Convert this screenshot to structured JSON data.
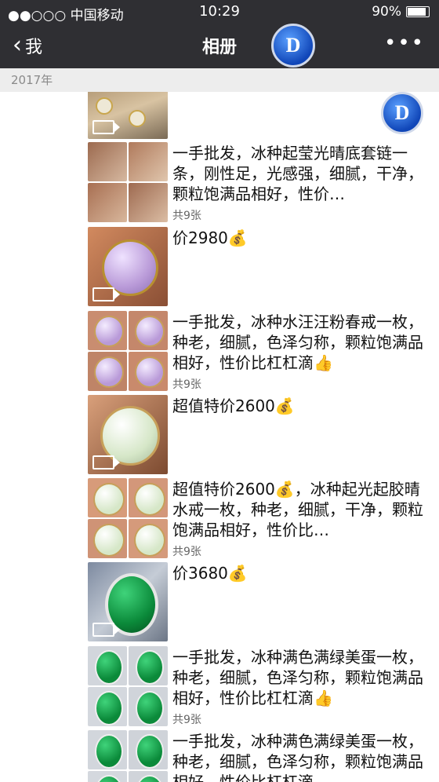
{
  "status": {
    "carrier": "●●○○○ 中国移动",
    "wifi_icon": "wifi-icon",
    "time": "10:29",
    "battery": "90%"
  },
  "nav": {
    "back_label": "我",
    "title": "相册",
    "more_label": "•••"
  },
  "logo_text": "D",
  "year": "2017年",
  "posts": [
    {
      "text": "",
      "count": ""
    },
    {
      "text": "一手批发，冰种起莹光晴底套链一条，刚性足，光感强，细腻，干净，颗粒饱满品相好，性价…",
      "count": "共9张"
    },
    {
      "text": "价2980💰",
      "count": ""
    },
    {
      "text": "一手批发，冰种水汪汪粉春戒一枚，种老，细腻，色泽匀称，颗粒饱满品相好，性价比杠杠滴👍",
      "count": "共9张"
    },
    {
      "text": "超值特价2600💰",
      "count": ""
    },
    {
      "text": "超值特价2600💰，冰种起光起胶晴水戒一枚，种老，细腻，干净，颗粒饱满品相好，性价比…",
      "count": "共9张"
    },
    {
      "text": "价3680💰",
      "count": ""
    },
    {
      "text": "一手批发，冰种满色满绿美蛋一枚，种老，细腻，色泽匀称，颗粒饱满品相好，性价比杠杠滴👍",
      "count": "共9张"
    },
    {
      "text": "一手批发，冰种满色满绿美蛋一枚，种老，细腻，色泽匀称，颗粒饱满品相好，性价比杠杠滴",
      "count": ""
    }
  ],
  "colors": {
    "nav_bg": "#2f2f33",
    "year_bar_bg": "#ededed",
    "lavender": "#b99ad8",
    "icy": "#d6e7c8",
    "green": "#0b8a3a"
  }
}
